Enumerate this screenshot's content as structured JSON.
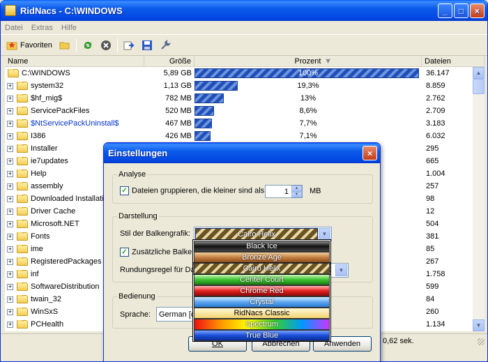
{
  "window": {
    "title": "RidNacs - C:\\WINDOWS",
    "minimize": "_",
    "maximize": "□",
    "close": "×"
  },
  "menu": [
    "Datei",
    "Extras",
    "Hilfe"
  ],
  "toolbar": {
    "favorites": "Favoriten"
  },
  "columns": {
    "name": "Name",
    "size": "Größe",
    "percent": "Prozent",
    "files": "Dateien"
  },
  "rows": [
    {
      "name": "C:\\WINDOWS",
      "size": "5,89 GB",
      "pct": "100%",
      "pct_value": 100,
      "files": "36.147",
      "root": true
    },
    {
      "name": "system32",
      "size": "1,13 GB",
      "pct": "19,3%",
      "pct_value": 19.3,
      "files": "8.859"
    },
    {
      "name": "$hf_mig$",
      "size": "782 MB",
      "pct": "13%",
      "pct_value": 13,
      "files": "2.762"
    },
    {
      "name": "ServicePackFiles",
      "size": "520 MB",
      "pct": "8,6%",
      "pct_value": 8.6,
      "files": "2.709"
    },
    {
      "name": "$NtServicePackUninstall$",
      "size": "467 MB",
      "pct": "7,7%",
      "pct_value": 7.7,
      "files": "3.183",
      "blue": true
    },
    {
      "name": "I386",
      "size": "426 MB",
      "pct": "7,1%",
      "pct_value": 7.1,
      "files": "6.032"
    },
    {
      "name": "Installer",
      "size": "",
      "pct": "",
      "pct_value": 0,
      "files": "295"
    },
    {
      "name": "ie7updates",
      "size": "",
      "pct": "",
      "pct_value": 0,
      "files": "665"
    },
    {
      "name": "Help",
      "size": "",
      "pct": "",
      "pct_value": 0,
      "files": "1.004"
    },
    {
      "name": "assembly",
      "size": "",
      "pct": "",
      "pct_value": 0,
      "files": "257"
    },
    {
      "name": "Downloaded Installations",
      "size": "",
      "pct": "",
      "pct_value": 0,
      "files": "98"
    },
    {
      "name": "Driver Cache",
      "size": "",
      "pct": "",
      "pct_value": 0,
      "files": "12"
    },
    {
      "name": "Microsoft.NET",
      "size": "",
      "pct": "",
      "pct_value": 0,
      "files": "504"
    },
    {
      "name": "Fonts",
      "size": "",
      "pct": "",
      "pct_value": 0,
      "files": "381"
    },
    {
      "name": "ime",
      "size": "",
      "pct": "",
      "pct_value": 0,
      "files": "85"
    },
    {
      "name": "RegisteredPackages",
      "size": "",
      "pct": "",
      "pct_value": 0,
      "files": "267"
    },
    {
      "name": "inf",
      "size": "",
      "pct": "",
      "pct_value": 0,
      "files": "1.758"
    },
    {
      "name": "SoftwareDistribution",
      "size": "",
      "pct": "",
      "pct_value": 0,
      "files": "599"
    },
    {
      "name": "twain_32",
      "size": "",
      "pct": "",
      "pct_value": 0,
      "files": "84"
    },
    {
      "name": "WinSxS",
      "size": "",
      "pct": "",
      "pct_value": 0,
      "files": "260"
    },
    {
      "name": "PCHealth",
      "size": "",
      "pct": "",
      "pct_value": 0,
      "files": "1.134"
    }
  ],
  "status": {
    "time": "0,62 sek."
  },
  "dialog": {
    "title": "Einstellungen",
    "analysis": {
      "group": "Analyse",
      "group_check_label": "Dateien gruppieren, die kleiner sind als:",
      "group_checked": true,
      "value": "1",
      "unit": "MB"
    },
    "display": {
      "group": "Darstellung",
      "style_label": "Stil der Balkengrafik:",
      "style_value": "Cairo Helix",
      "extra_label": "Zusätzliche Balken",
      "extra_checked": true,
      "rounding_label": "Rundungsregel für Da"
    },
    "control": {
      "group": "Bedienung",
      "language_label": "Sprache:",
      "language_value": "German [d"
    },
    "buttons": {
      "ok": "OK",
      "cancel": "Abbrechen",
      "apply": "Anwenden"
    }
  },
  "style_options": [
    {
      "label": "Black Ice",
      "bg": "linear-gradient(#8b8b8b,#111 50%,#444)"
    },
    {
      "label": "Bronze Age",
      "bg": "linear-gradient(#f1cf9c,#c0793a 55%,#8a4e1e)"
    },
    {
      "label": "Cairo Helix",
      "bg": "repeating-linear-gradient(135deg,#6b5320 0 6px,#e6d7a8 6px 10px)",
      "selected": true
    },
    {
      "label": "Center Court",
      "bg": "linear-gradient(#c9f8b8,#3cc22f 50%,#1d7c14)"
    },
    {
      "label": "Chrome Red",
      "bg": "linear-gradient(#ffb5b5,#e51e1e 50%,#8c0a0a)"
    },
    {
      "label": "Crystal",
      "bg": "linear-gradient(#d7ecff,#5da7f0 50%,#2a7bd6)"
    },
    {
      "label": "RidNacs Classic",
      "bg": "linear-gradient(#fff8d8,#f3d470)",
      "dark": true
    },
    {
      "label": "Spectrum",
      "bg": "linear-gradient(90deg,#e11,#f90,#ff0,#3c3,#09f,#c3f)"
    },
    {
      "label": "True Blue",
      "bg": "linear-gradient(#7aa2ff,#1a4ed8 50%,#0b2e96)"
    }
  ]
}
